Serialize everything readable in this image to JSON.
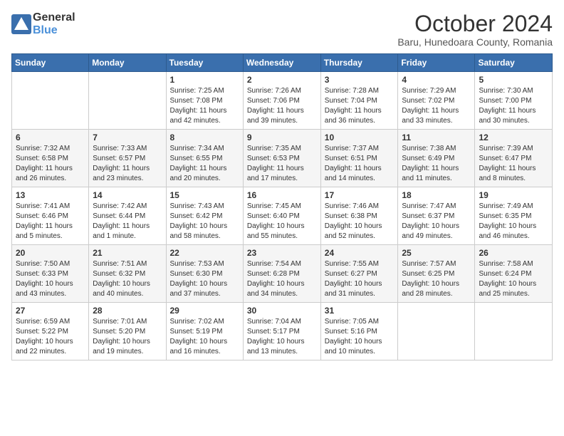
{
  "header": {
    "logo_general": "General",
    "logo_blue": "Blue",
    "month_title": "October 2024",
    "location": "Baru, Hunedoara County, Romania"
  },
  "weekdays": [
    "Sunday",
    "Monday",
    "Tuesday",
    "Wednesday",
    "Thursday",
    "Friday",
    "Saturday"
  ],
  "weeks": [
    [
      {
        "day": "",
        "sunrise": "",
        "sunset": "",
        "daylight": ""
      },
      {
        "day": "",
        "sunrise": "",
        "sunset": "",
        "daylight": ""
      },
      {
        "day": "1",
        "sunrise": "Sunrise: 7:25 AM",
        "sunset": "Sunset: 7:08 PM",
        "daylight": "Daylight: 11 hours and 42 minutes."
      },
      {
        "day": "2",
        "sunrise": "Sunrise: 7:26 AM",
        "sunset": "Sunset: 7:06 PM",
        "daylight": "Daylight: 11 hours and 39 minutes."
      },
      {
        "day": "3",
        "sunrise": "Sunrise: 7:28 AM",
        "sunset": "Sunset: 7:04 PM",
        "daylight": "Daylight: 11 hours and 36 minutes."
      },
      {
        "day": "4",
        "sunrise": "Sunrise: 7:29 AM",
        "sunset": "Sunset: 7:02 PM",
        "daylight": "Daylight: 11 hours and 33 minutes."
      },
      {
        "day": "5",
        "sunrise": "Sunrise: 7:30 AM",
        "sunset": "Sunset: 7:00 PM",
        "daylight": "Daylight: 11 hours and 30 minutes."
      }
    ],
    [
      {
        "day": "6",
        "sunrise": "Sunrise: 7:32 AM",
        "sunset": "Sunset: 6:58 PM",
        "daylight": "Daylight: 11 hours and 26 minutes."
      },
      {
        "day": "7",
        "sunrise": "Sunrise: 7:33 AM",
        "sunset": "Sunset: 6:57 PM",
        "daylight": "Daylight: 11 hours and 23 minutes."
      },
      {
        "day": "8",
        "sunrise": "Sunrise: 7:34 AM",
        "sunset": "Sunset: 6:55 PM",
        "daylight": "Daylight: 11 hours and 20 minutes."
      },
      {
        "day": "9",
        "sunrise": "Sunrise: 7:35 AM",
        "sunset": "Sunset: 6:53 PM",
        "daylight": "Daylight: 11 hours and 17 minutes."
      },
      {
        "day": "10",
        "sunrise": "Sunrise: 7:37 AM",
        "sunset": "Sunset: 6:51 PM",
        "daylight": "Daylight: 11 hours and 14 minutes."
      },
      {
        "day": "11",
        "sunrise": "Sunrise: 7:38 AM",
        "sunset": "Sunset: 6:49 PM",
        "daylight": "Daylight: 11 hours and 11 minutes."
      },
      {
        "day": "12",
        "sunrise": "Sunrise: 7:39 AM",
        "sunset": "Sunset: 6:47 PM",
        "daylight": "Daylight: 11 hours and 8 minutes."
      }
    ],
    [
      {
        "day": "13",
        "sunrise": "Sunrise: 7:41 AM",
        "sunset": "Sunset: 6:46 PM",
        "daylight": "Daylight: 11 hours and 5 minutes."
      },
      {
        "day": "14",
        "sunrise": "Sunrise: 7:42 AM",
        "sunset": "Sunset: 6:44 PM",
        "daylight": "Daylight: 11 hours and 1 minute."
      },
      {
        "day": "15",
        "sunrise": "Sunrise: 7:43 AM",
        "sunset": "Sunset: 6:42 PM",
        "daylight": "Daylight: 10 hours and 58 minutes."
      },
      {
        "day": "16",
        "sunrise": "Sunrise: 7:45 AM",
        "sunset": "Sunset: 6:40 PM",
        "daylight": "Daylight: 10 hours and 55 minutes."
      },
      {
        "day": "17",
        "sunrise": "Sunrise: 7:46 AM",
        "sunset": "Sunset: 6:38 PM",
        "daylight": "Daylight: 10 hours and 52 minutes."
      },
      {
        "day": "18",
        "sunrise": "Sunrise: 7:47 AM",
        "sunset": "Sunset: 6:37 PM",
        "daylight": "Daylight: 10 hours and 49 minutes."
      },
      {
        "day": "19",
        "sunrise": "Sunrise: 7:49 AM",
        "sunset": "Sunset: 6:35 PM",
        "daylight": "Daylight: 10 hours and 46 minutes."
      }
    ],
    [
      {
        "day": "20",
        "sunrise": "Sunrise: 7:50 AM",
        "sunset": "Sunset: 6:33 PM",
        "daylight": "Daylight: 10 hours and 43 minutes."
      },
      {
        "day": "21",
        "sunrise": "Sunrise: 7:51 AM",
        "sunset": "Sunset: 6:32 PM",
        "daylight": "Daylight: 10 hours and 40 minutes."
      },
      {
        "day": "22",
        "sunrise": "Sunrise: 7:53 AM",
        "sunset": "Sunset: 6:30 PM",
        "daylight": "Daylight: 10 hours and 37 minutes."
      },
      {
        "day": "23",
        "sunrise": "Sunrise: 7:54 AM",
        "sunset": "Sunset: 6:28 PM",
        "daylight": "Daylight: 10 hours and 34 minutes."
      },
      {
        "day": "24",
        "sunrise": "Sunrise: 7:55 AM",
        "sunset": "Sunset: 6:27 PM",
        "daylight": "Daylight: 10 hours and 31 minutes."
      },
      {
        "day": "25",
        "sunrise": "Sunrise: 7:57 AM",
        "sunset": "Sunset: 6:25 PM",
        "daylight": "Daylight: 10 hours and 28 minutes."
      },
      {
        "day": "26",
        "sunrise": "Sunrise: 7:58 AM",
        "sunset": "Sunset: 6:24 PM",
        "daylight": "Daylight: 10 hours and 25 minutes."
      }
    ],
    [
      {
        "day": "27",
        "sunrise": "Sunrise: 6:59 AM",
        "sunset": "Sunset: 5:22 PM",
        "daylight": "Daylight: 10 hours and 22 minutes."
      },
      {
        "day": "28",
        "sunrise": "Sunrise: 7:01 AM",
        "sunset": "Sunset: 5:20 PM",
        "daylight": "Daylight: 10 hours and 19 minutes."
      },
      {
        "day": "29",
        "sunrise": "Sunrise: 7:02 AM",
        "sunset": "Sunset: 5:19 PM",
        "daylight": "Daylight: 10 hours and 16 minutes."
      },
      {
        "day": "30",
        "sunrise": "Sunrise: 7:04 AM",
        "sunset": "Sunset: 5:17 PM",
        "daylight": "Daylight: 10 hours and 13 minutes."
      },
      {
        "day": "31",
        "sunrise": "Sunrise: 7:05 AM",
        "sunset": "Sunset: 5:16 PM",
        "daylight": "Daylight: 10 hours and 10 minutes."
      },
      {
        "day": "",
        "sunrise": "",
        "sunset": "",
        "daylight": ""
      },
      {
        "day": "",
        "sunrise": "",
        "sunset": "",
        "daylight": ""
      }
    ]
  ]
}
